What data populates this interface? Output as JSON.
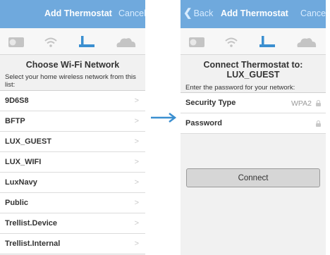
{
  "left": {
    "nav": {
      "title": "Add Thermostat",
      "cancel": "Cancel"
    },
    "heading": "Choose Wi-Fi Network",
    "instruction": "Select your home wireless network from this list:",
    "networks": [
      "9D6S8",
      "BFTP",
      "LUX_GUEST",
      "LUX_WIFI",
      "LuxNavy",
      "Public",
      "Trellist.Device",
      "Trellist.Internal"
    ],
    "chevron": ">"
  },
  "right": {
    "nav": {
      "back": "Back",
      "title": "Add Thermostat",
      "cancel": "Cancel"
    },
    "heading_line1": "Connect Thermostat to:",
    "heading_line2": "LUX_GUEST",
    "instruction": "Enter the password for your network:",
    "security_label": "Security Type",
    "security_value": "WPA2",
    "password_label": "Password",
    "connect": "Connect"
  },
  "steps": [
    "thermostat-icon",
    "wifi-icon",
    "router-icon",
    "cloud-icon"
  ],
  "active_step": "router-icon",
  "colors": {
    "nav": "#6fa9dd",
    "accent": "#3b8fd0",
    "inactive_icon": "#c4c4c4",
    "background": "#f1f1f1"
  }
}
